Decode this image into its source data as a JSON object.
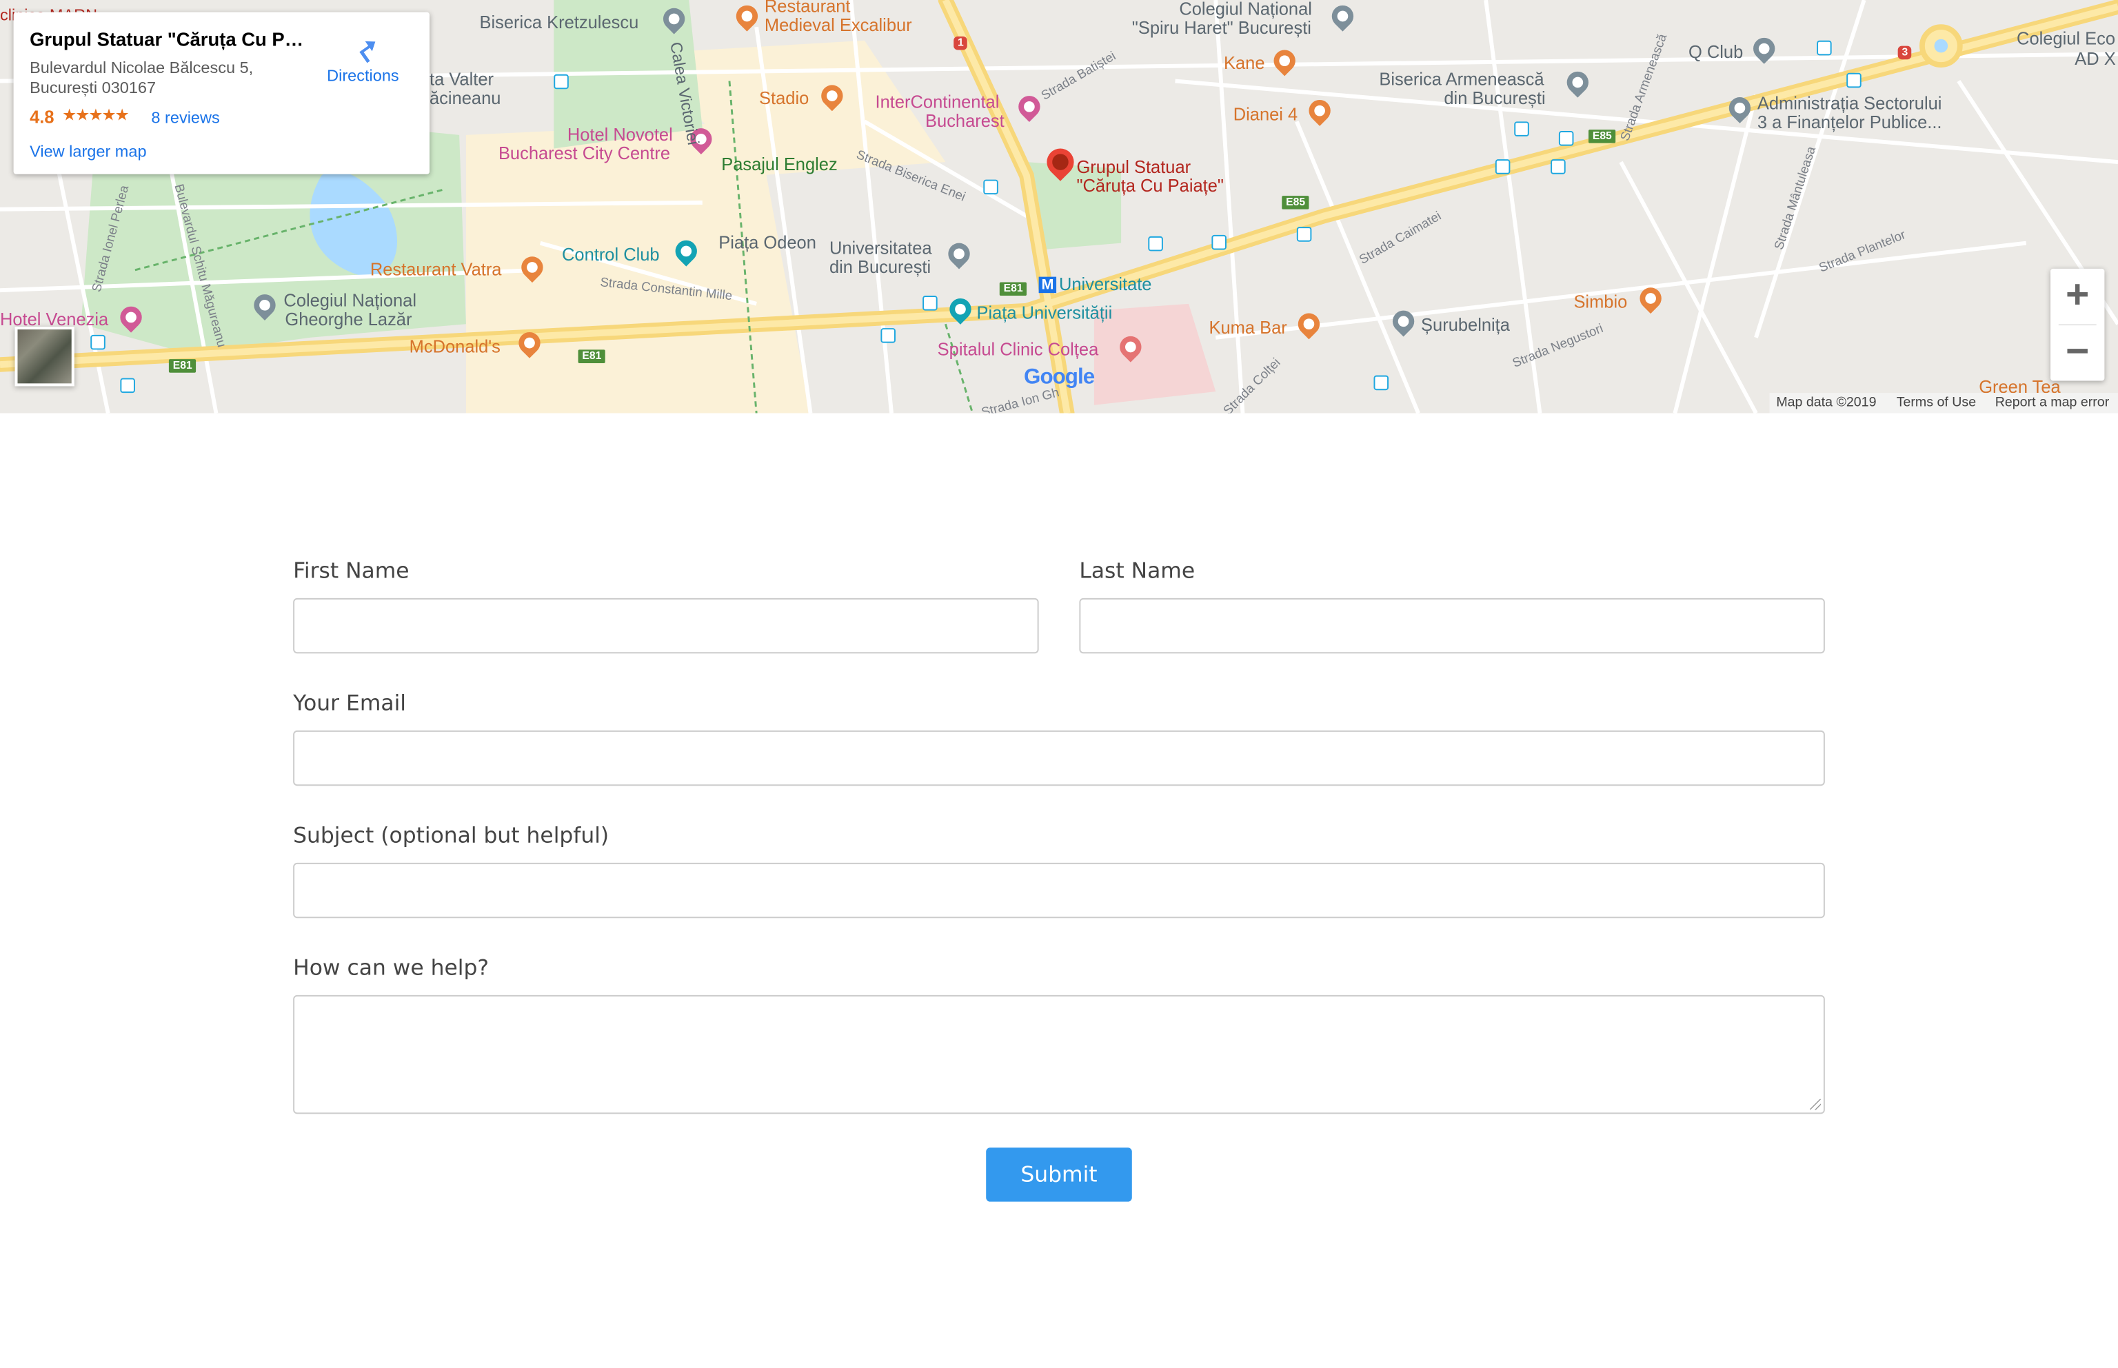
{
  "map": {
    "place_card": {
      "title": "Grupul Statuar \"Căruța Cu Pai...",
      "address_line1": "Bulevardul Nicolae Bălcescu 5,",
      "address_line2": "București 030167",
      "rating": "4.8",
      "stars": "★★★★★",
      "reviews": "8 reviews",
      "directions_label": "Directions",
      "larger_map_label": "View larger map"
    },
    "labels": {
      "biserica_kretzulescu": "Biserica Kretzulescu",
      "restaurant_excalibur_1": "Restaurant",
      "restaurant_excalibur_2": "Medieval Excalibur",
      "colegiul_spiru_1": "Colegiul Național",
      "colegiul_spiru_2": "\"Spiru Haret\" București",
      "q_club": "Q Club",
      "colegiul_eco_1": "Colegiul Eco",
      "colegiul_eco_2": "AD X",
      "ta_valter_1": "ta Valter",
      "ta_valter_2": "ăcineanu",
      "stadio": "Stadio",
      "kane": "Kane",
      "biserica_armeneasca_1": "Biserica Armenească",
      "biserica_armeneasca_2": "din București",
      "intercontinental_1": "InterContinental",
      "intercontinental_2": "Bucharest",
      "dianei": "Dianei 4",
      "administratia_1": "Administrația Sectorului",
      "administratia_2": "3 a Finanțelor Publice...",
      "hotel_novotel_1": "Hotel Novotel",
      "hotel_novotel_2": "Bucharest City Centre",
      "pasajul_englez": "Pasajul Englez",
      "grupul_statuar_1": "Grupul Statuar",
      "grupul_statuar_2": "\"Căruța Cu Paiațe\"",
      "control_club": "Control Club",
      "piata_odeon": "Piața Odeon",
      "universitatea_1": "Universitatea",
      "universitatea_2": "din București",
      "restaurant_vatra": "Restaurant Vatra",
      "simbio": "Simbio",
      "universitate": "Universitate",
      "colegiul_lazar_1": "Colegiul Național",
      "colegiul_lazar_2": "Gheorghe Lazăr",
      "piata_universitatii": "Piața Universității",
      "kuma_bar": "Kuma Bar",
      "surubelnita": "Șurubelnița",
      "hotel_venezia": "Hotel Venezia",
      "mcdonalds": "McDonald's",
      "spitalul_coltea": "Spitalul Clinic Colțea",
      "green_tea": "Green Tea",
      "clinica_marn": "clinica MARN",
      "calea_victoriei": "Calea Victoriei"
    },
    "streets": {
      "strada_batistei": "Strada Batiștei",
      "strada_armeneasca": "Strada Armenească",
      "strada_biserica_enei": "Strada Biserica Enei",
      "strada_caimatei": "Strada Caimatei",
      "strada_manuleasa": "Strada Mântuleasa",
      "strada_plantelor": "Strada Plantelor",
      "strada_ionel_perlea": "Strada Ionel Perlea",
      "bulevardul_schitu": "Bulevardul Schitu Măgureanu",
      "strada_constantin_mille": "Strada Constantin Mille",
      "strada_negustori": "Strada Negustori",
      "strada_coltei": "Strada Colței",
      "strada_ion": "Strada Ion Gh"
    },
    "shields": {
      "e81_a": "E81",
      "e81_b": "E81",
      "e81_c": "E81",
      "e85_a": "E85",
      "e85_b": "E85",
      "r1": "1",
      "r3": "3"
    },
    "metro_letter": "M",
    "google_logo": "Google",
    "zoom_in": "+",
    "zoom_out": "−",
    "attribution": {
      "map_data": "Map data ©2019",
      "terms": "Terms of Use",
      "report": "Report a map error"
    }
  },
  "form": {
    "first_name_label": "First Name",
    "last_name_label": "Last Name",
    "email_label": "Your Email",
    "subject_label": "Subject (optional but helpful)",
    "message_label": "How can we help?",
    "submit_label": "Submit"
  }
}
